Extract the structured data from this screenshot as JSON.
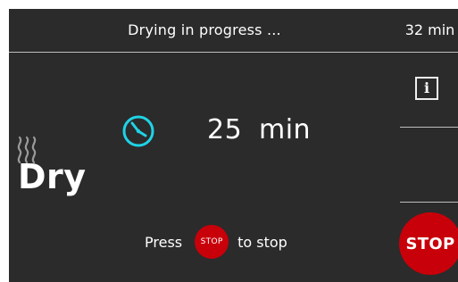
{
  "status": {
    "title": "Drying in progress ...",
    "remaining_time": "32 min"
  },
  "sidebar": {
    "info_label": "i"
  },
  "timer": {
    "icon": "clock-icon",
    "value": "25",
    "unit": "min"
  },
  "program": {
    "icon": "steam-icon",
    "name": "Dry"
  },
  "hint": {
    "prefix": "Press",
    "button_label": "STOP",
    "suffix": "to stop"
  },
  "stop_button": {
    "label": "STOP"
  },
  "colors": {
    "background": "#2b2b2b",
    "accent_cyan": "#1fd3e6",
    "stop_red": "#c8000a",
    "divider": "#bdbdbd"
  }
}
